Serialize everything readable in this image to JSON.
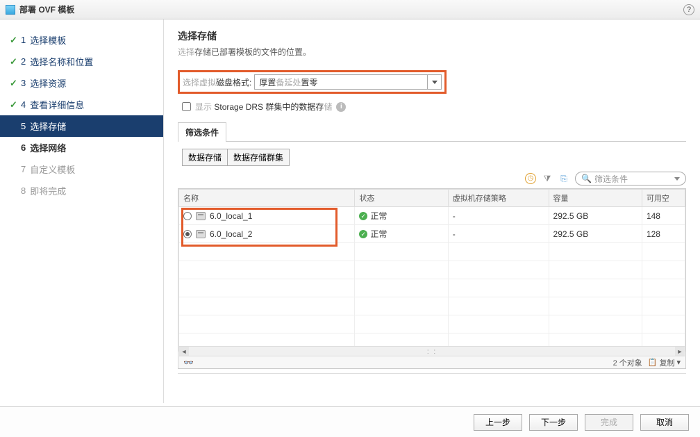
{
  "window": {
    "title": "部署 OVF 模板"
  },
  "steps": [
    {
      "num": "1",
      "label": "选择模板",
      "state": "done"
    },
    {
      "num": "2",
      "label": "选择名称和位置",
      "state": "done"
    },
    {
      "num": "3",
      "label": "选择资源",
      "state": "done"
    },
    {
      "num": "4",
      "label": "查看详细信息",
      "state": "done"
    },
    {
      "num": "5",
      "label": "选择存储",
      "state": "current"
    },
    {
      "num": "6",
      "label": "选择网络",
      "state": "pending"
    },
    {
      "num": "7",
      "label": "自定义模板",
      "state": "pending"
    },
    {
      "num": "8",
      "label": "即将完成",
      "state": "pending"
    }
  ],
  "panel": {
    "heading": "选择存储",
    "desc_pre": "选择",
    "desc_mid": "存储",
    "desc_post": "已部署模板的文件的位置。",
    "disk_label_pre": "选择虚拟",
    "disk_label_mid": "磁盘格式:",
    "disk_format_pre": "厚置",
    "disk_format_mid": "备延处",
    "disk_format_post": "置零",
    "drs_pre": "显示",
    "drs_mid": " Storage DRS 群集中的数据存",
    "drs_post": "储",
    "filter_tab": "筛选条件",
    "btn_datastores": "数据存储",
    "btn_clusters": "数据存储群集",
    "filter_placeholder": "筛选条件"
  },
  "columns": {
    "name": "名称",
    "status": "状态",
    "policy": "虚拟机存储策略",
    "capacity": "容量",
    "available": "可用空"
  },
  "rows": [
    {
      "name": "6.0_local_1",
      "selected": false,
      "status": "正常",
      "policy": "-",
      "capacity": "292.5 GB",
      "available": "148"
    },
    {
      "name": "6.0_local_2",
      "selected": true,
      "status": "正常",
      "policy": "-",
      "capacity": "292.5 GB",
      "available": "128"
    }
  ],
  "footer_table": {
    "count": "2 个对象",
    "copy": "复制"
  },
  "buttons": {
    "back": "上一步",
    "next": "下一步",
    "finish": "完成",
    "cancel": "取消"
  }
}
